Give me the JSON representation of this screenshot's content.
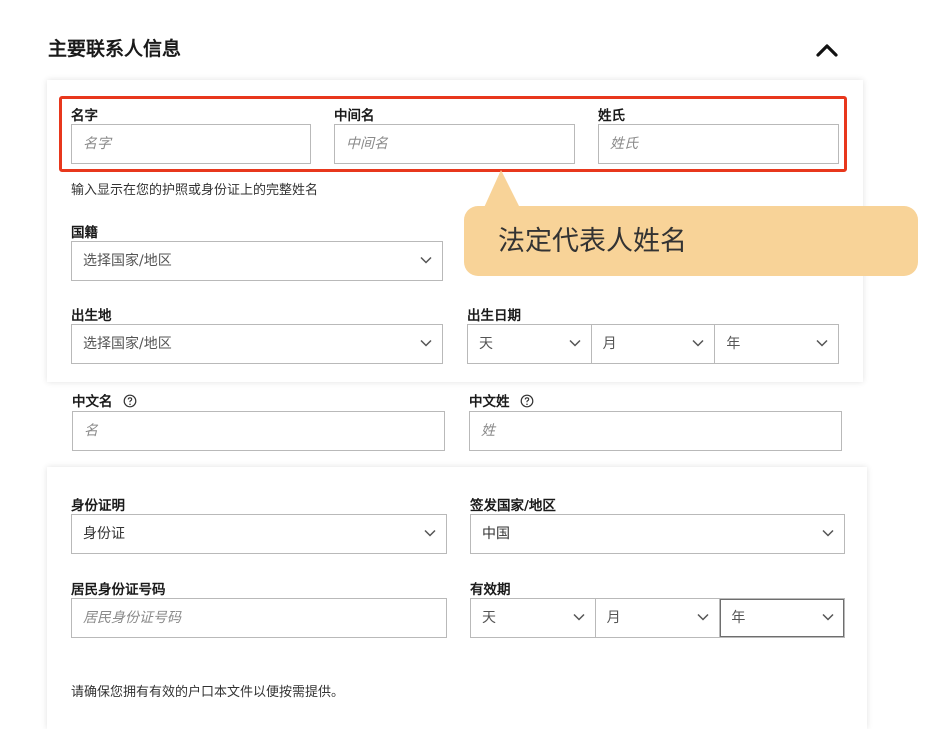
{
  "section": {
    "title": "主要联系人信息"
  },
  "name_fields": {
    "first_label": "名字",
    "first_placeholder": "名字",
    "middle_label": "中间名",
    "middle_placeholder": "中间名",
    "last_label": "姓氏",
    "last_placeholder": "姓氏",
    "hint": "输入显示在您的护照或身份证上的完整姓名"
  },
  "callout": {
    "text": "法定代表人姓名"
  },
  "nationality": {
    "label": "国籍",
    "value": "选择国家/地区"
  },
  "birthplace": {
    "label": "出生地",
    "value": "选择国家/地区"
  },
  "birthdate": {
    "label": "出生日期",
    "day": "天",
    "month": "月",
    "year": "年"
  },
  "chinese_name": {
    "given_label": "中文名",
    "given_placeholder": "名",
    "family_label": "中文姓",
    "family_placeholder": "姓"
  },
  "id_section": {
    "id_type_label": "身份证明",
    "id_type_value": "身份证",
    "issuer_label": "签发国家/地区",
    "issuer_value": "中国",
    "id_number_label": "居民身份证号码",
    "id_number_placeholder": "居民身份证号码",
    "expiry_label": "有效期",
    "expiry_day": "天",
    "expiry_month": "月",
    "expiry_year": "年",
    "footer_note": "请确保您拥有有效的户口本文件以便按需提供。"
  },
  "colors": {
    "highlight": "#e8371c",
    "callout_bg": "#f8d398"
  },
  "icons": {
    "collapse": "chevron-up-icon",
    "dropdown": "chevron-down-icon",
    "help": "help-circle-icon"
  }
}
